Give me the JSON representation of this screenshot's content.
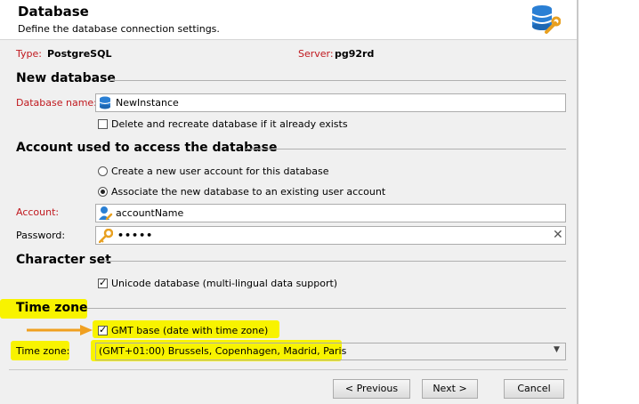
{
  "header": {
    "title": "Database",
    "subtitle": "Define the database connection settings.",
    "icon": "database-wrench-icon"
  },
  "connection": {
    "type_label": "Type:",
    "type_value": "PostgreSQL",
    "server_label": "Server:",
    "server_value": "pg92rd"
  },
  "new_database": {
    "section_title": "New database",
    "name_label": "Database name:",
    "name_value": "NewInstance",
    "recreate_label": "Delete and recreate database if it already exists",
    "recreate_checked": false
  },
  "account": {
    "section_title": "Account used to access the database",
    "option_create": "Create a new user account for this database",
    "option_associate": "Associate the new database to an existing user account",
    "selected_option": "associate",
    "account_label": "Account:",
    "account_value": "accountName",
    "password_label": "Password:",
    "password_value": "•••••"
  },
  "charset": {
    "section_title": "Character set",
    "unicode_label": "Unicode database (multi-lingual data support)",
    "unicode_checked": true
  },
  "timezone": {
    "section_title": "Time zone",
    "gmt_label": "GMT base (date with time zone)",
    "gmt_checked": true,
    "tz_label": "Time zone:",
    "tz_value": "(GMT+01:00) Brussels, Copenhagen, Madrid, Paris",
    "highlight_color": "#f8f300"
  },
  "buttons": {
    "previous": "< Previous",
    "next": "Next >",
    "cancel": "Cancel"
  },
  "colors": {
    "required_label": "#c0181e",
    "highlight": "#f8f300",
    "annotation_arrow": "#f0a020"
  }
}
